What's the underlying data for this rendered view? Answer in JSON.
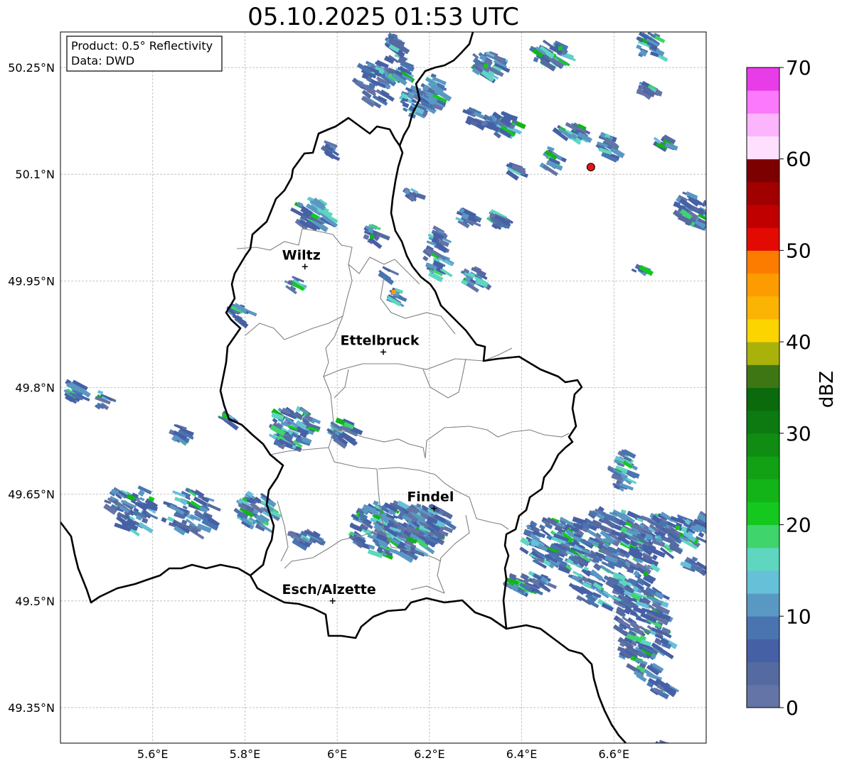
{
  "title": "05.10.2025 01:53 UTC",
  "info_box": {
    "line1": "Product: 0.5° Reflectivity",
    "line2": "Data: DWD"
  },
  "lat_labels": [
    "50.25°N",
    "50.1°N",
    "49.95°N",
    "49.8°N",
    "49.65°N",
    "49.5°N",
    "49.35°N"
  ],
  "lon_labels": [
    "5.6°E",
    "5.8°E",
    "6°E",
    "6.2°E",
    "6.4°E",
    "6.6°E"
  ],
  "cities": [
    {
      "name": "Wiltz",
      "lon": 5.93,
      "lat": 49.97
    },
    {
      "name": "Ettelbruck",
      "lon": 6.1,
      "lat": 49.85
    },
    {
      "name": "Findel",
      "lon": 6.21,
      "lat": 49.63
    },
    {
      "name": "Esch/Alzette",
      "lon": 5.99,
      "lat": 49.5
    }
  ],
  "radar_site": {
    "lon": 6.55,
    "lat": 50.11,
    "color": "#e0161b"
  },
  "colorbar": {
    "label": "dBZ",
    "ticks": [
      "0",
      "10",
      "20",
      "30",
      "40",
      "50",
      "60",
      "70"
    ],
    "colors": [
      "#6474a6",
      "#556aa0",
      "#4660a6",
      "#4a74b0",
      "#5a98c4",
      "#66c0d8",
      "#5ed6c0",
      "#3fd46c",
      "#14c81e",
      "#12b418",
      "#12a014",
      "#108c12",
      "#0c7a10",
      "#0a6a0c",
      "#3e7614",
      "#a9b20a",
      "#fcd400",
      "#fcb404",
      "#fc9c00",
      "#fc7c00",
      "#e40a04",
      "#c00000",
      "#a00000",
      "#7c0000",
      "#fee0fe",
      "#fcb4fc",
      "#fc78fc",
      "#e83ce8"
    ]
  }
}
